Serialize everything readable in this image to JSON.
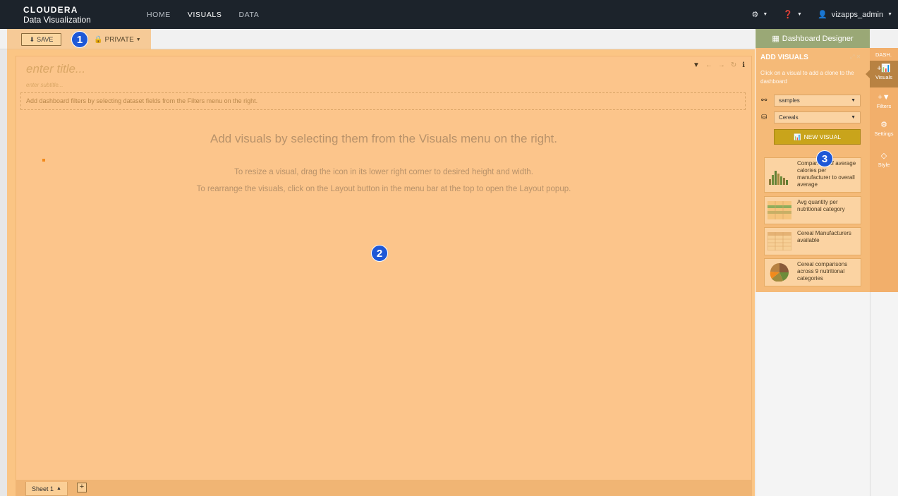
{
  "brand": {
    "line1": "CLOUDERA",
    "line2": "Data Visualization"
  },
  "nav": [
    {
      "label": "HOME",
      "active": false
    },
    {
      "label": "VISUALS",
      "active": true
    },
    {
      "label": "DATA",
      "active": false
    }
  ],
  "topRight": {
    "user": "vizapps_admin"
  },
  "toolbar": {
    "save_label": "SAVE",
    "private_label": "PRIVATE"
  },
  "canvas": {
    "title_placeholder": "enter title...",
    "subtitle_placeholder": "enter subtitle...",
    "filter_hint": "Add dashboard filters by selecting dataset fields from the Filters menu on the right.",
    "main_message": "Add visuals by selecting them from the Visuals menu on the right.",
    "sub_message_1": "To resize a visual, drag the icon in its lower right corner to desired height and width.",
    "sub_message_2": "To rearrange the visuals, click on the Layout button in the menu bar at the top to open the Layout popup."
  },
  "sheets": {
    "tab_label": "Sheet 1",
    "add_label": "+"
  },
  "badges": [
    "1",
    "2",
    "3"
  ],
  "panel": {
    "header": "Dashboard Designer",
    "title": "ADD VISUALS",
    "help": "Click on a visual to add a clone to the dashboard",
    "connection": "samples",
    "dataset": "Cereals",
    "new_visual_label": "NEW VISUAL",
    "visuals": [
      "Comparison of average calories per manufacturer to overall average",
      "Avg quantity per nutritional category",
      "Cereal Manufacturers available",
      "Cereal comparisons across 9 nutritional categories"
    ]
  },
  "sideTabs": {
    "dash_label": "DASH.",
    "items": [
      "Visuals",
      "Filters",
      "Settings",
      "Style"
    ]
  },
  "colors": {
    "accent": "#f5ba78",
    "navbar": "#1c232b",
    "badge": "#1f58d6",
    "newVisual": "#c9a41b"
  }
}
